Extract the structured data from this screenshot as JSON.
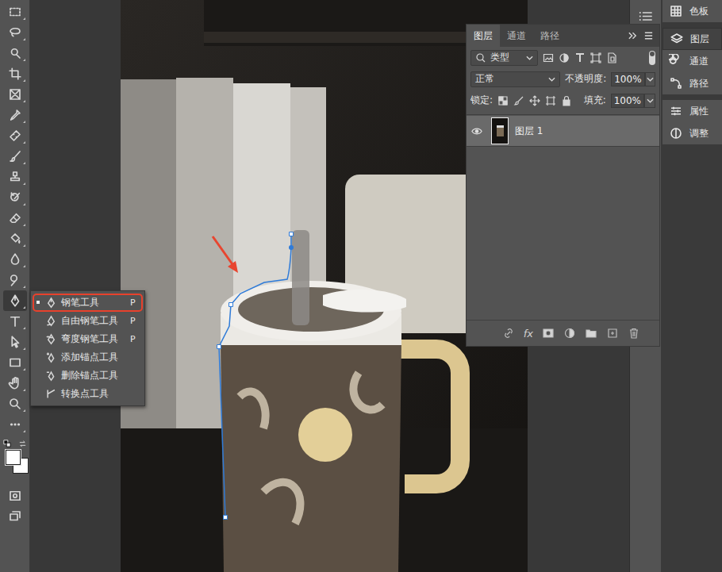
{
  "toolbar": {
    "tools": [
      {
        "selected": false
      },
      {
        "selected": false
      },
      {
        "selected": false
      },
      {
        "selected": false
      },
      {
        "selected": false
      },
      {
        "selected": false
      },
      {
        "selected": false
      },
      {
        "selected": false
      },
      {
        "selected": false
      },
      {
        "selected": false
      },
      {
        "selected": false
      },
      {
        "selected": false
      },
      {
        "selected": false
      },
      {
        "selected": false
      },
      {
        "selected": true
      },
      {
        "selected": false
      },
      {
        "selected": false
      },
      {
        "selected": false
      },
      {
        "selected": false
      },
      {
        "selected": false
      },
      {
        "selected": false
      }
    ],
    "extraTools": [
      {
        "selected": false
      },
      {
        "selected": false
      }
    ]
  },
  "flyout": {
    "items": [
      {
        "label": "钢笔工具",
        "shortcut": "P",
        "selected": true
      },
      {
        "label": "自由钢笔工具",
        "shortcut": "P",
        "selected": false
      },
      {
        "label": "弯度钢笔工具",
        "shortcut": "P",
        "selected": false
      },
      {
        "label": "添加锚点工具",
        "shortcut": "",
        "selected": false
      },
      {
        "label": "删除锚点工具",
        "shortcut": "",
        "selected": false
      },
      {
        "label": "转换点工具",
        "shortcut": "",
        "selected": false
      }
    ]
  },
  "layersPanel": {
    "tabs": [
      {
        "label": "图层",
        "selected": true
      },
      {
        "label": "通道",
        "selected": false
      },
      {
        "label": "路径",
        "selected": false
      }
    ],
    "filter": {
      "value": "类型"
    },
    "blendMode": {
      "value": "正常"
    },
    "opacity": {
      "label": "不透明度:",
      "value": "100%"
    },
    "lock": {
      "label": "锁定:"
    },
    "fill": {
      "label": "填充:",
      "value": "100%"
    },
    "layers": [
      {
        "name": "图层 1",
        "visible": true,
        "selected": true
      }
    ],
    "bottomBar": {
      "fx": "fx"
    }
  },
  "dock": {
    "groups": [
      {
        "items": [
          {
            "label": "色板",
            "selected": false
          }
        ]
      },
      {
        "items": [
          {
            "label": "图层",
            "selected": true
          },
          {
            "label": "通道",
            "selected": false
          },
          {
            "label": "路径",
            "selected": false
          }
        ]
      },
      {
        "items": [
          {
            "label": "属性",
            "selected": false
          },
          {
            "label": "调整",
            "selected": false
          }
        ]
      }
    ]
  }
}
